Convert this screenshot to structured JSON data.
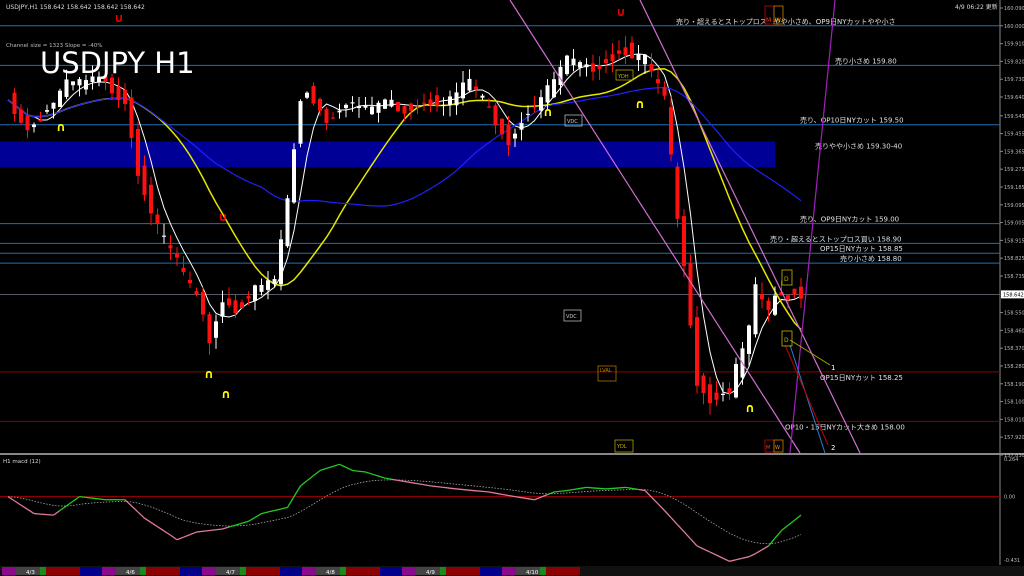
{
  "window": {
    "symbol_info": "USDJPY,H1  158.642 158.642 158.642 158.642",
    "big_title": "USDJPY H1",
    "channel_info": "Channel size = 1323  Slope = -40%",
    "updated": "4/9 06:22 更新",
    "macd_label": "H1  macd (12)"
  },
  "chart_data": {
    "type": "candlestick",
    "title": "USDJPY H1",
    "ylim": [
      157.83,
      160.09
    ],
    "price_ticks": [
      "160.090",
      "160.000",
      "159.910",
      "159.820",
      "159.730",
      "159.640",
      "159.545",
      "159.455",
      "159.365",
      "159.275",
      "159.185",
      "159.095",
      "159.005",
      "158.915",
      "158.825",
      "158.735",
      "158.550",
      "158.460",
      "158.370",
      "158.280",
      "158.190",
      "158.100",
      "158.010",
      "157.920",
      "157.830"
    ],
    "price_tick_values": [
      160.09,
      160.0,
      159.91,
      159.82,
      159.73,
      159.64,
      159.545,
      159.455,
      159.365,
      159.275,
      159.185,
      159.095,
      159.005,
      158.915,
      158.825,
      158.735,
      158.55,
      158.46,
      158.37,
      158.28,
      158.19,
      158.1,
      158.01,
      157.92,
      157.83
    ],
    "current_price": "158.642",
    "current_price_value": 158.642,
    "x_labels": [
      "4/3",
      "4/6",
      "4/7",
      "4/8",
      "4/9",
      "4/10"
    ],
    "close_path_bar_index": [
      0,
      3,
      6,
      9,
      14,
      18,
      20,
      23,
      26,
      29,
      31,
      33,
      35,
      38,
      41,
      43,
      45,
      46,
      49,
      52,
      55,
      58,
      61,
      64,
      68,
      71,
      74,
      77,
      80,
      83,
      86,
      89,
      92,
      95,
      98,
      101,
      103,
      105,
      106,
      108,
      111,
      114,
      115,
      117,
      118,
      120,
      121
    ],
    "close_path_price": [
      159.625,
      159.473,
      159.574,
      159.701,
      159.726,
      159.625,
      159.271,
      158.968,
      158.816,
      158.614,
      158.411,
      158.614,
      158.563,
      158.664,
      158.715,
      159.119,
      159.625,
      159.675,
      159.524,
      159.625,
      159.574,
      159.625,
      159.574,
      159.625,
      159.625,
      159.726,
      159.574,
      159.423,
      159.574,
      159.675,
      159.827,
      159.777,
      159.827,
      159.878,
      159.827,
      159.625,
      159.018,
      158.513,
      158.209,
      158.108,
      158.159,
      158.462,
      158.664,
      158.563,
      158.614,
      158.64,
      158.642
    ],
    "levels": [
      {
        "price": 160.0,
        "label": "売り・超えるとストップロス　やや小さめ、OP9日NYカットやや小さ",
        "color": "#1e6fb8"
      },
      {
        "price": 159.8,
        "label": "売り小さめ 159.80",
        "color": "#1e6fb8"
      },
      {
        "price": 159.5,
        "label": "売り、OP10日NYカット 159.50",
        "color": "#1e6fb8"
      },
      {
        "price": 159.0,
        "label": "売り、OP9日NYカット 159.00",
        "color": "#1e6fb8"
      },
      {
        "price": 158.9,
        "label": "売り・超えるとストップロス買い 158.90",
        "color": "#1e6fb8"
      },
      {
        "price": 158.85,
        "label": "OP15日NYカット 158.85",
        "color": "#1e6fb8"
      },
      {
        "price": 158.8,
        "label": "売り小さめ 158.80",
        "color": "#1e6fb8"
      },
      {
        "price": 158.25,
        "label": "OP15日NYカット 158.25",
        "color": "#8b0000"
      },
      {
        "price": 158.0,
        "label": "OP10・15日NYカット大きめ 158.00",
        "color": "#8b0000"
      }
    ],
    "zone": {
      "from": 159.3,
      "to": 159.4,
      "label": "売りやや小さめ 159.30-40",
      "color": "#0000c8"
    },
    "macd": {
      "ylim": [
        -0.431,
        0.264
      ],
      "ticks": [
        "0.264",
        "0.00",
        "-0.431"
      ],
      "bar_index": [
        0,
        4,
        7,
        9,
        11,
        15,
        18,
        21,
        25,
        26,
        29,
        31,
        33,
        37,
        39,
        43,
        45,
        48,
        51,
        53,
        55,
        58,
        65,
        69,
        74,
        78,
        81,
        84,
        86,
        89,
        92,
        95,
        98,
        101,
        106,
        111,
        114,
        115,
        117,
        119,
        122
      ],
      "values": [
        0.0,
        -0.11,
        -0.12,
        -0.06,
        0.0,
        -0.02,
        -0.02,
        -0.14,
        -0.25,
        -0.28,
        -0.23,
        -0.22,
        -0.21,
        -0.16,
        -0.11,
        -0.07,
        0.07,
        0.17,
        0.21,
        0.17,
        0.16,
        0.12,
        0.07,
        0.05,
        0.03,
        0.0,
        -0.02,
        0.03,
        0.04,
        0.06,
        0.05,
        0.06,
        0.04,
        -0.09,
        -0.32,
        -0.42,
        -0.39,
        -0.37,
        -0.32,
        -0.22,
        -0.12
      ]
    }
  },
  "markers": {
    "vdc": "VDC",
    "ydh": "YDH",
    "lval": "LVAL",
    "ydl": "YDL",
    "d": "D",
    "m": "M",
    "w": "W",
    "one": "1",
    "two": "2"
  },
  "colors": {
    "bull": "#ffffff",
    "bear": "#ff1010",
    "ma_fast": "#ffffff",
    "ma_mid": "#e6e600",
    "ma_slow": "#2020ff",
    "macd_up": "#22cc22",
    "macd_down": "#e07aa0"
  }
}
